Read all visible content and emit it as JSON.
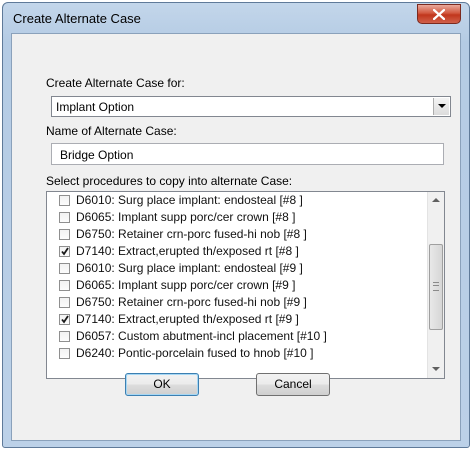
{
  "window": {
    "title": "Create Alternate Case"
  },
  "form": {
    "case_for_label": "Create Alternate Case for:",
    "case_for_value": "Implant Option",
    "name_label": "Name of Alternate Case:",
    "name_value": "Bridge Option",
    "procedures_label": "Select procedures to copy into alternate Case:"
  },
  "procedures": [
    {
      "text": "D6010: Surg place implant: endosteal [#8 ]",
      "checked": false
    },
    {
      "text": "D6065: Implant supp porc/cer crown [#8 ]",
      "checked": false
    },
    {
      "text": "D6750: Retainer crn-porc fused-hi nob [#8 ]",
      "checked": false
    },
    {
      "text": "D7140: Extract,erupted th/exposed rt [#8 ]",
      "checked": true
    },
    {
      "text": "D6010: Surg place implant: endosteal [#9 ]",
      "checked": false
    },
    {
      "text": "D6065: Implant supp porc/cer crown [#9 ]",
      "checked": false
    },
    {
      "text": "D6750: Retainer crn-porc fused-hi nob [#9 ]",
      "checked": false
    },
    {
      "text": "D7140: Extract,erupted th/exposed rt [#9 ]",
      "checked": true
    },
    {
      "text": "D6057: Custom abutment-incl placement [#10 ]",
      "checked": false
    },
    {
      "text": "D6240: Pontic-porcelain fused to hnob [#10 ]",
      "checked": false
    }
  ],
  "buttons": {
    "ok": "OK",
    "cancel": "Cancel"
  },
  "icons": {
    "close": "close-icon",
    "dropdown": "chevron-down-icon",
    "scroll_up": "scroll-up-arrow-icon",
    "scroll_down": "scroll-down-arrow-icon",
    "check": "checkmark-icon"
  },
  "colors": {
    "frame": "#b9cfe7",
    "close_button": "#c9452c",
    "client": "#f0f0f0"
  }
}
